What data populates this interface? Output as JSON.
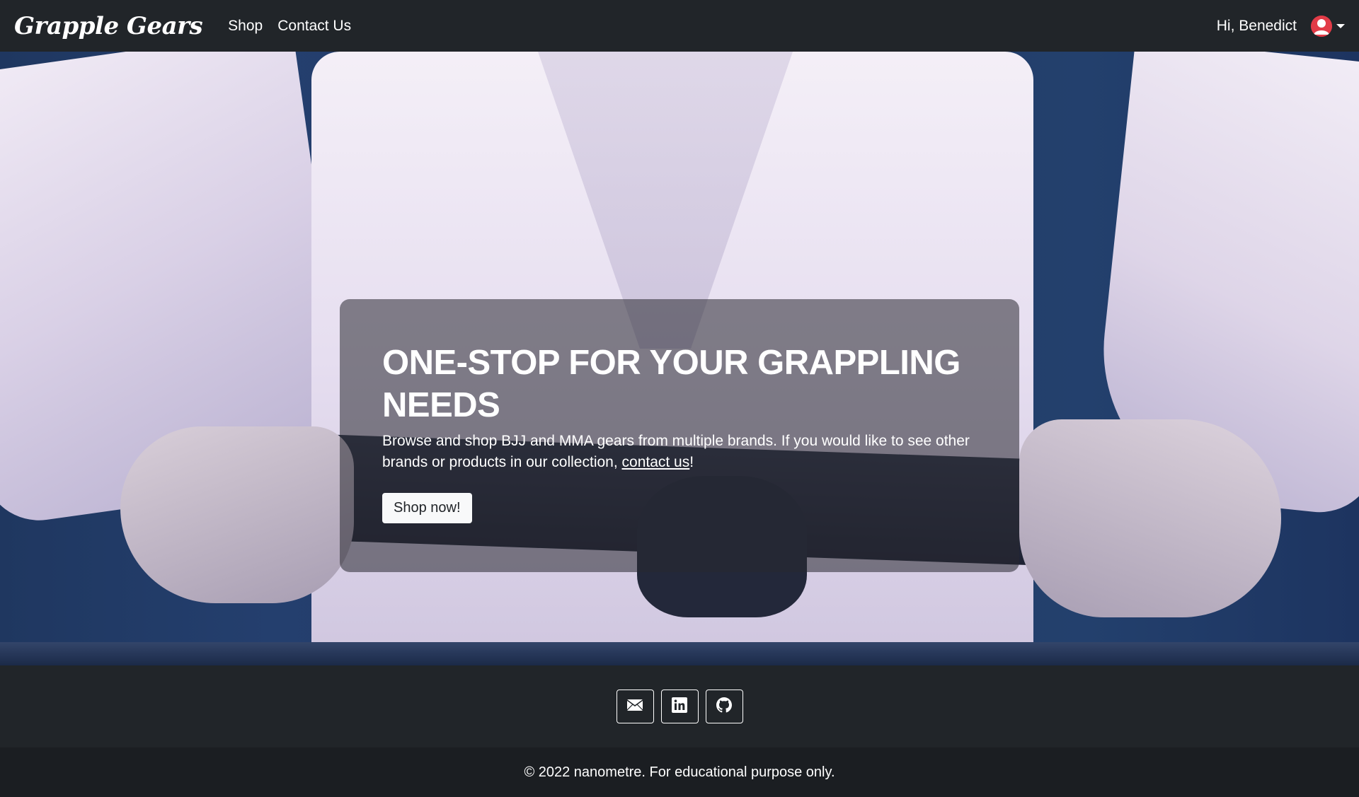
{
  "navbar": {
    "brand": "Grapple Gears",
    "links": [
      {
        "label": "Shop"
      },
      {
        "label": "Contact Us"
      }
    ],
    "greeting": "Hi, Benedict",
    "avatar_icon": "user-avatar-icon",
    "accent_color": "#e23b47"
  },
  "hero": {
    "title": "ONE-STOP FOR YOUR GRAPPLING NEEDS",
    "text_before_link": "Browse and shop BJJ and MMA gears from multiple brands. If you would like to see other brands or products in our collection, ",
    "link_label": "contact us",
    "text_after_link": "!",
    "button_label": "Shop now!"
  },
  "footer": {
    "social": [
      {
        "icon": "envelope-icon"
      },
      {
        "icon": "linkedin-icon"
      },
      {
        "icon": "github-icon"
      }
    ],
    "copyright": "© 2022 nanometre. For educational purpose only."
  }
}
